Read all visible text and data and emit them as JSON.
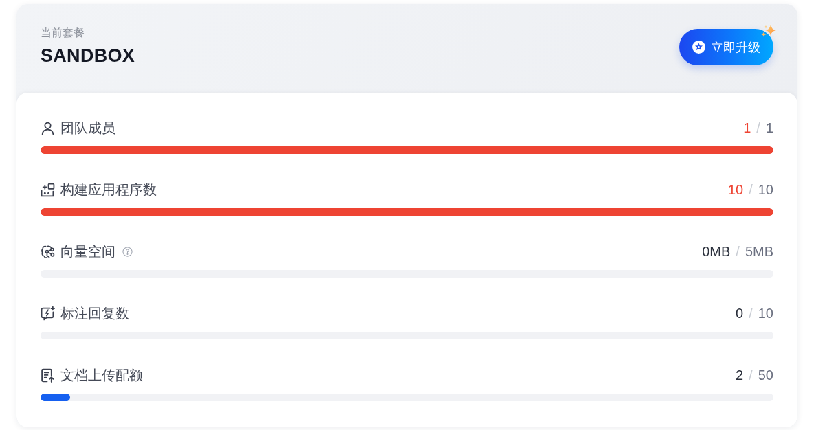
{
  "plan": {
    "caption": "当前套餐",
    "name": "SANDBOX",
    "upgrade_button": "立即升级"
  },
  "rows": [
    {
      "kind": "members",
      "label": "团队成员",
      "help": false,
      "used": "1",
      "separator": "/",
      "limit": "1",
      "level": 1,
      "at_limit": true
    },
    {
      "kind": "apps",
      "label": "构建应用程序数",
      "help": false,
      "used": "10",
      "separator": "/",
      "limit": "10",
      "level": 1,
      "at_limit": true
    },
    {
      "kind": "vectors",
      "label": "向量空间",
      "help": true,
      "used": "0MB",
      "separator": "/",
      "limit": "5MB",
      "level": 0,
      "at_limit": false
    },
    {
      "kind": "annotations",
      "label": "标注回复数",
      "help": false,
      "used": "0",
      "separator": "/",
      "limit": "10",
      "level": 0,
      "at_limit": false
    },
    {
      "kind": "documents",
      "label": "文档上传配额",
      "help": false,
      "used": "2",
      "separator": "/",
      "limit": "50",
      "level": 0.04,
      "at_limit": false
    }
  ]
}
